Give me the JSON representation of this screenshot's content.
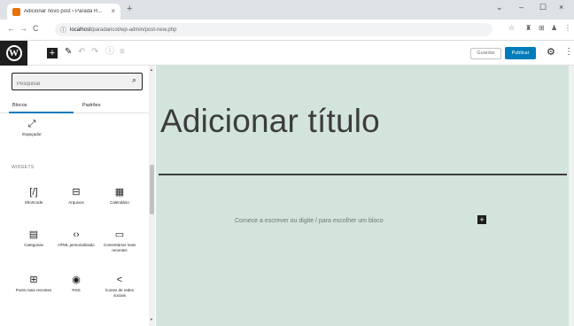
{
  "browser": {
    "tab_title": "Adicionar novo post ‹ Parada R... ",
    "tab_close": "×",
    "new_tab": "+",
    "window_controls": [
      "⌄",
      "–",
      "☐",
      "×"
    ],
    "nav": {
      "back": "←",
      "forward": "→",
      "reload": "C"
    },
    "url_host": "localhost",
    "url_path": "/paradaricot/wp-admin/post-new.php",
    "info_icon": "ⓘ",
    "extensions": [
      "☆",
      "♜",
      "⊞",
      "♟",
      "⋮"
    ]
  },
  "wp_toolbar": {
    "logo": "W",
    "inserter": "+",
    "tools": [
      "✎",
      "↶",
      "↷",
      "ⓘ",
      "≡"
    ],
    "save_draft": "Guardar",
    "publish": "Publicar",
    "settings": "⚙",
    "more": "⋮"
  },
  "sidebar": {
    "search_placeholder": "Pesquisar",
    "search_icon": "⌕",
    "tabs": [
      "Blocos",
      "Padrões"
    ],
    "spacer_block": {
      "icon": "⤢",
      "label": "Espaçador"
    },
    "section_label": "WIDGETS",
    "widgets": [
      {
        "icon": "[/]",
        "label": "Shortcode"
      },
      {
        "icon": "⊟",
        "label": "Arquivos"
      },
      {
        "icon": "▦",
        "label": "Calendário"
      },
      {
        "icon": "▤",
        "label": "Categorias"
      },
      {
        "icon": "‹›",
        "label": "HTML personalizado"
      },
      {
        "icon": "▭",
        "label": "Comentários mais recentes"
      },
      {
        "icon": "⊞",
        "label": "Posts mais recentes"
      },
      {
        "icon": "◉",
        "label": "RSS"
      },
      {
        "icon": "<",
        "label": "Ícones de redes sociais"
      }
    ],
    "scroll_up": "▲",
    "scroll_down": "▼"
  },
  "editor": {
    "title_placeholder": "Adicionar título",
    "block_placeholder": "Comece a escrever ou digite / para escolher um bloco",
    "add_block": "+"
  }
}
